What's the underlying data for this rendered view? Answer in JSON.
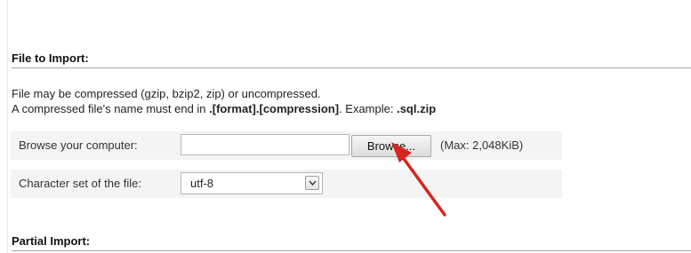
{
  "colors": {
    "annotation_arrow": "#d8241f",
    "row_background": "#f4f4f4",
    "divider": "#a8a8a8"
  },
  "sections": {
    "file_to_import": {
      "title": "File to Import:",
      "description_line1": "File may be compressed (gzip, bzip2, zip) or uncompressed.",
      "description_line2_prefix": "A compressed file's name must end in ",
      "description_line2_format": ".[format].[compression]",
      "description_line2_middle": ". Example: ",
      "description_line2_example": ".sql.zip"
    },
    "partial_import": {
      "title": "Partial Import:"
    }
  },
  "browse_row": {
    "label": "Browse your computer:",
    "file_value": "",
    "button_label": "Browse...",
    "max_note": "(Max: 2,048KiB)"
  },
  "charset_row": {
    "label": "Character set of the file:",
    "selected_value": "utf-8",
    "dropdown_icon": "chevron-down-icon"
  },
  "annotation": {
    "icon": "red-arrow-icon"
  }
}
